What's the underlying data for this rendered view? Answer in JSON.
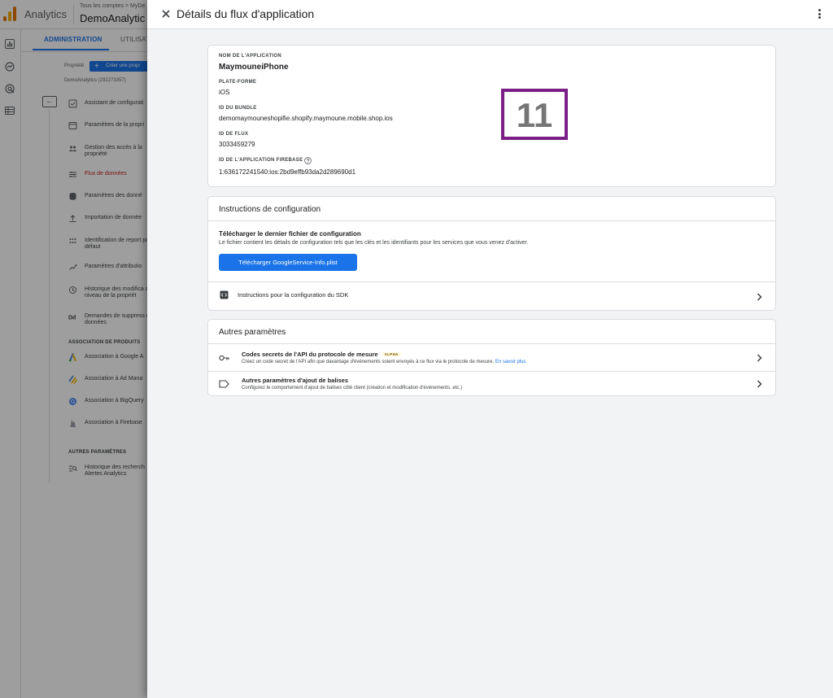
{
  "background": {
    "product_name": "Analytics",
    "breadcrumb": "Tous les comptes > MyDe",
    "account_name": "DemoAnalytic",
    "tabs": [
      "ADMINISTRATION",
      "UTILISAT"
    ],
    "property_label": "Propriété",
    "create_property_button": "Créer une propr",
    "property_name": "DemoAnalytics (292273357)",
    "nav_items": [
      {
        "label": "Assistant de configurati",
        "icon": "checklist-icon"
      },
      {
        "label": "Paramètres de la propri",
        "icon": "browser-icon"
      },
      {
        "label": "Gestion des accès à la propriété",
        "icon": "people-icon"
      },
      {
        "label": "Flux de données",
        "icon": "data-streams-icon"
      },
      {
        "label": "Paramètres des donné",
        "icon": "database-icon"
      },
      {
        "label": "Importation de donnée",
        "icon": "upload-icon"
      },
      {
        "label": "Identification de report par défaut",
        "icon": "identity-icon"
      },
      {
        "label": "Paramètres d'attributio",
        "icon": "attribution-icon"
      },
      {
        "label": "Historique des modifica au niveau de la propriét",
        "icon": "history-icon"
      },
      {
        "label": "Demandes de suppress des données",
        "icon": "dd-icon"
      }
    ],
    "section_products": "ASSOCIATION DE PRODUITS",
    "product_links": [
      {
        "label": "Association à Google A",
        "icon": "google-ads-icon"
      },
      {
        "label": "Association à Ad Mana",
        "icon": "ad-manager-icon"
      },
      {
        "label": "Association à BigQuery",
        "icon": "bigquery-icon"
      },
      {
        "label": "Association à Firebase",
        "icon": "firebase-icon"
      }
    ],
    "section_other": "AUTRES PARAMÈTRES",
    "other_items": [
      {
        "label": "Historique des recherch Alertes Analytics",
        "icon": "search-history-icon"
      }
    ]
  },
  "panel": {
    "title": "Détails du flux d'application",
    "details": {
      "app_name_label": "NOM DE L'APPLICATION",
      "app_name_value": "MaymouneiPhone",
      "platform_label": "PLATE-FORME",
      "platform_value": "iOS",
      "bundle_label": "ID DU BUNDLE",
      "bundle_value": "demomaymouneshopifie.shopify.maymoune.mobile.shop.ios",
      "stream_id_label": "ID DE FLUX",
      "stream_id_value": "3033459279",
      "firebase_label": "ID DE L'APPLICATION FIREBASE",
      "firebase_value": "1:636172241540:ios:2bd9effb93da2d289690d1"
    },
    "step_badge": "11",
    "config": {
      "title": "Instructions de configuration",
      "download_title": "Télécharger le dernier fichier de configuration",
      "download_desc": "Le fichier contient les détails de configuration tels que les clés et les identifiants pour les services que vous venez d'activer.",
      "download_button": "Télécharger GoogleService-Info.plist",
      "sdk_label": "Instructions pour la configuration du SDK"
    },
    "other": {
      "title": "Autres paramètres",
      "secrets_title": "Codes secrets de l'API du protocole de mesure",
      "secrets_badge": "ALPHA",
      "secrets_desc": "Créez un code secret de l'API afin que davantage d'événements soient envoyés à ce flux via le protocole de mesure.",
      "secrets_link": "En savoir plus",
      "tagging_title": "Autres paramètres d'ajout de balises",
      "tagging_desc": "Configurez le comportement d'ajout de balises côté client (création et modification d'événements, etc.)"
    }
  },
  "colors": {
    "accent": "#1a73e8",
    "badge_border": "#7b1e86",
    "active_nav": "#c5221f"
  }
}
